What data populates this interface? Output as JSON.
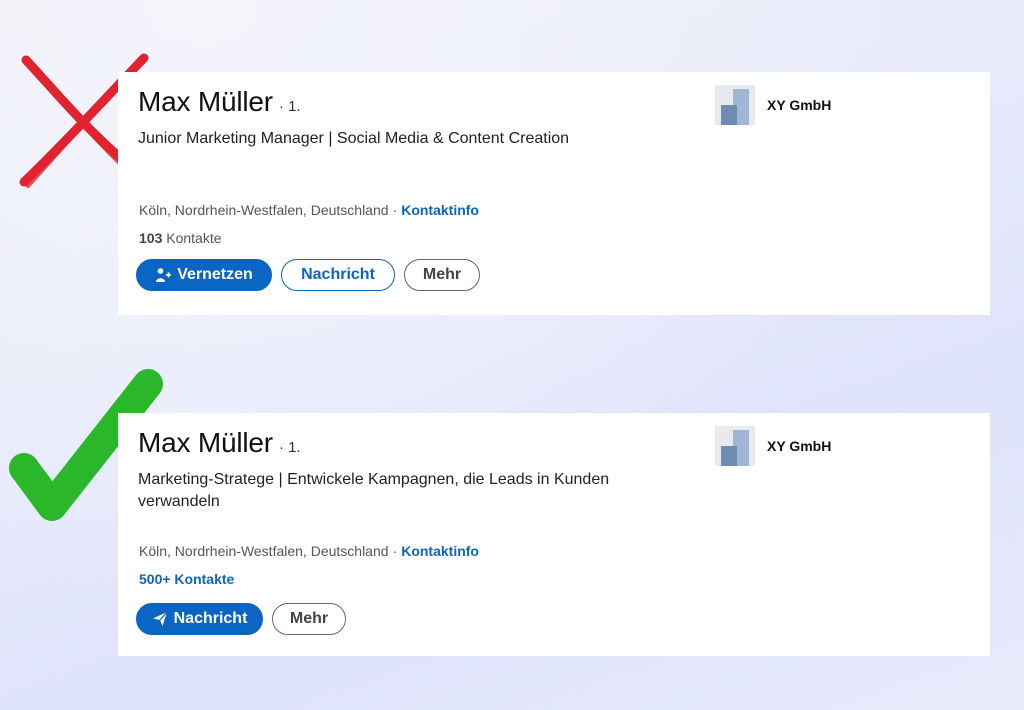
{
  "colors": {
    "accent": "#0a66c2",
    "cross": "#e0232f",
    "check": "#2ab82a"
  },
  "icons": {
    "bad": "cross-mark-icon",
    "good": "check-mark-icon",
    "connect": "person-add-icon",
    "send": "paper-plane-icon"
  },
  "profiles": [
    {
      "name": "Max Müller",
      "degree": "· 1.",
      "headline": "Junior Marketing Manager | Social Media & Content Creation",
      "location": "Köln, Nordrhein-Westfalen, Deutschland",
      "location_sep": "·",
      "contact_info": "Kontaktinfo",
      "connections_count": "103",
      "connections_label": "Kontakte",
      "company": "XY GmbH",
      "buttons": {
        "connect": "Vernetzen",
        "message": "Nachricht",
        "more": "Mehr"
      }
    },
    {
      "name": "Max Müller",
      "degree": "· 1.",
      "headline": "Marketing-Stratege | Entwickele Kampagnen, die Leads in Kunden verwandeln",
      "location": "Köln, Nordrhein-Westfalen, Deutschland",
      "location_sep": "·",
      "contact_info": "Kontaktinfo",
      "connections": "500+ Kontakte",
      "company": "XY GmbH",
      "buttons": {
        "message": "Nachricht",
        "more": "Mehr"
      }
    }
  ]
}
